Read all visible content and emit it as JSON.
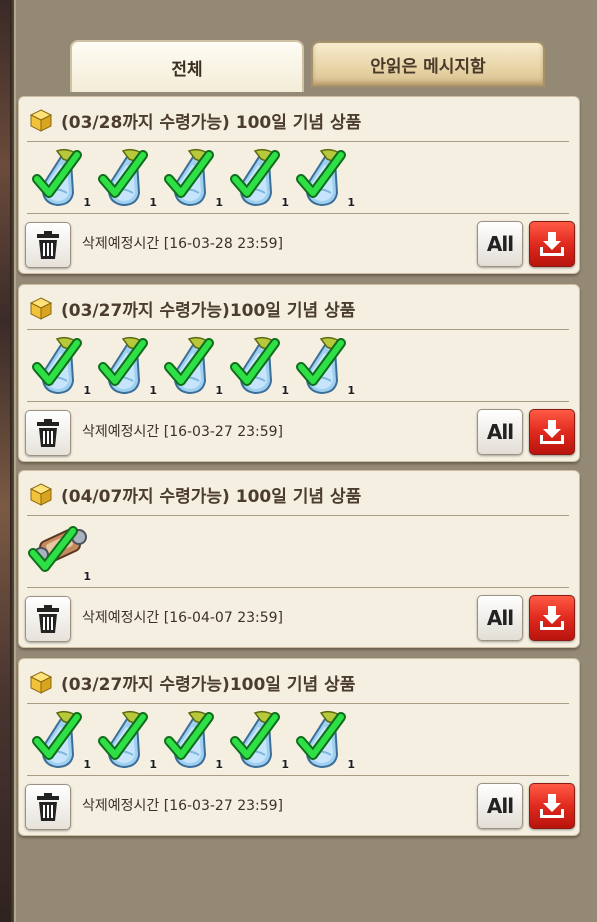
{
  "tabs": [
    {
      "label": "전체",
      "active": true
    },
    {
      "label": "안읽은 메시지함",
      "active": false
    }
  ],
  "messages": [
    {
      "title": "(03/28까지 수령가능) 100일 기념 상품",
      "items": [
        {
          "icon": "potion-flask-icon",
          "qty": "1"
        },
        {
          "icon": "potion-flask-icon",
          "qty": "1"
        },
        {
          "icon": "potion-flask-icon",
          "qty": "1"
        },
        {
          "icon": "potion-flask-icon",
          "qty": "1"
        },
        {
          "icon": "potion-flask-icon",
          "qty": "1"
        }
      ],
      "delete_time": "삭제예정시간 [16-03-28 23:59]",
      "all_label": "All"
    },
    {
      "title": "(03/27까지 수령가능)100일 기념 상품",
      "items": [
        {
          "icon": "potion-flask-icon",
          "qty": "1"
        },
        {
          "icon": "potion-flask-icon",
          "qty": "1"
        },
        {
          "icon": "potion-flask-icon",
          "qty": "1"
        },
        {
          "icon": "potion-flask-icon",
          "qty": "1"
        },
        {
          "icon": "potion-flask-icon",
          "qty": "1"
        }
      ],
      "delete_time": "삭제예정시간 [16-03-27 23:59]",
      "all_label": "All"
    },
    {
      "title": "(04/07까지 수령가능) 100일 기념 상품",
      "items": [
        {
          "icon": "scroll-item-icon",
          "qty": "1"
        }
      ],
      "delete_time": "삭제예정시간 [16-04-07 23:59]",
      "all_label": "All"
    },
    {
      "title": "(03/27까지 수령가능)100일 기념 상품",
      "items": [
        {
          "icon": "potion-flask-icon",
          "qty": "1"
        },
        {
          "icon": "potion-flask-icon",
          "qty": "1"
        },
        {
          "icon": "potion-flask-icon",
          "qty": "1"
        },
        {
          "icon": "potion-flask-icon",
          "qty": "1"
        },
        {
          "icon": "potion-flask-icon",
          "qty": "1"
        }
      ],
      "delete_time": "삭제예정시간 [16-03-27 23:59]",
      "all_label": "All"
    }
  ],
  "colors": {
    "card_bg": "#f5efe1",
    "receive_button": "#e02a1e",
    "check": "#22c93a"
  }
}
